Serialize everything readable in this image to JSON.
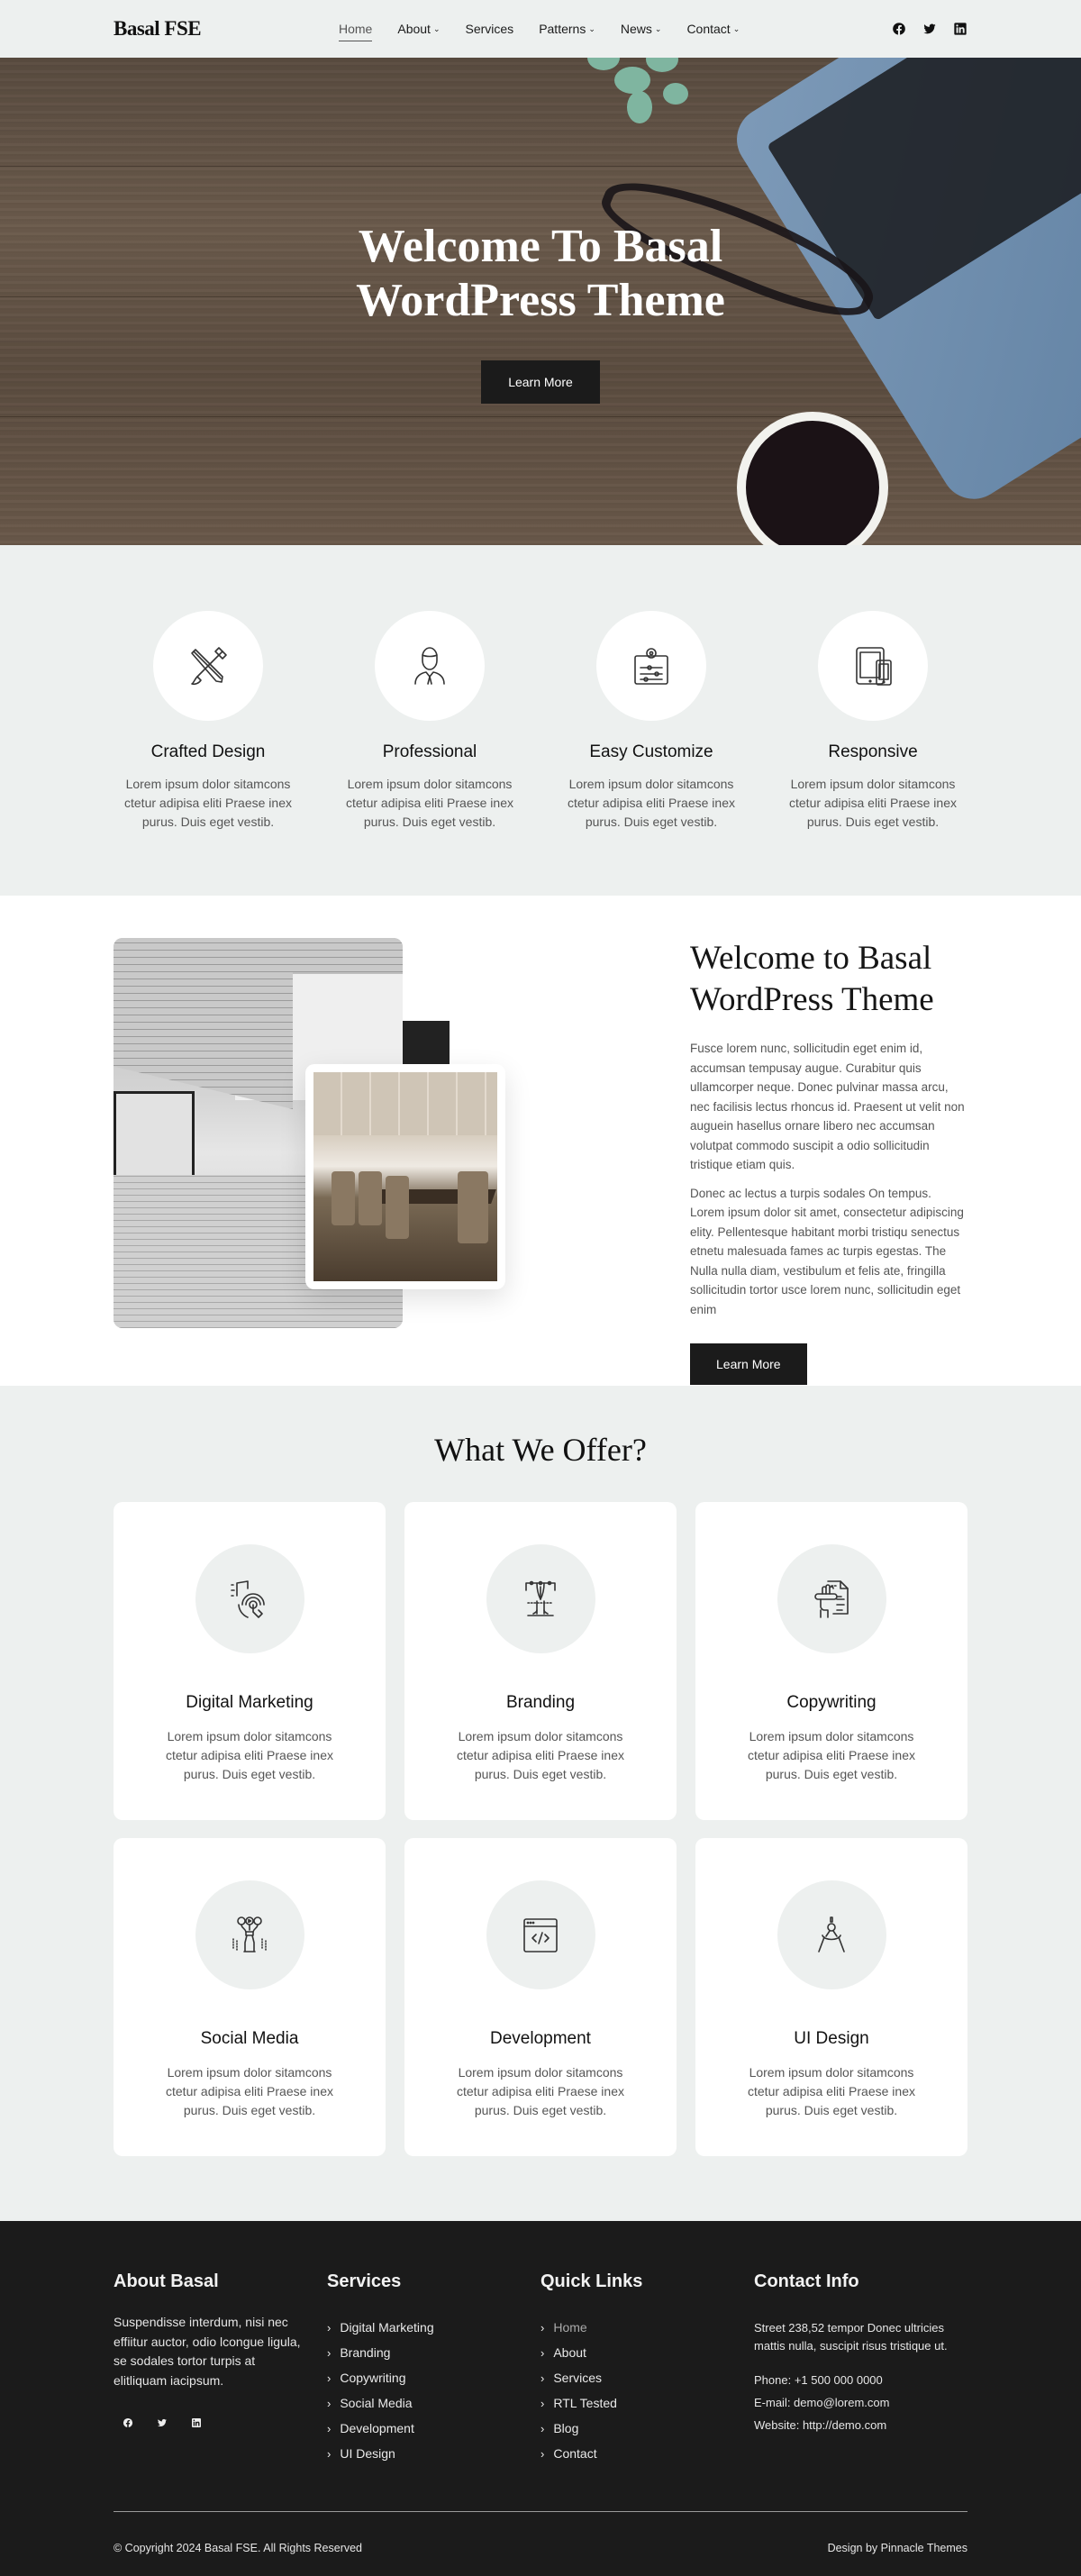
{
  "header": {
    "logo": "Basal FSE",
    "nav": [
      {
        "label": "Home",
        "active": true,
        "dropdown": false
      },
      {
        "label": "About",
        "dropdown": true
      },
      {
        "label": "Services",
        "dropdown": false
      },
      {
        "label": "Patterns",
        "dropdown": true
      },
      {
        "label": "News",
        "dropdown": true
      },
      {
        "label": "Contact",
        "dropdown": true
      }
    ],
    "social": [
      "facebook-icon",
      "twitter-icon",
      "linkedin-icon"
    ]
  },
  "hero": {
    "title_line1": "Welcome To Basal",
    "title_line2": "WordPress Theme",
    "button": "Learn More"
  },
  "features": [
    {
      "title": "Crafted Design",
      "desc": "Lorem ipsum dolor sitamcons ctetur adipisa eliti Praese inex purus. Duis eget vestib.",
      "icon": "pencil-brush-icon"
    },
    {
      "title": "Professional",
      "desc": "Lorem ipsum dolor sitamcons ctetur adipisa eliti Praese inex purus. Duis eget vestib.",
      "icon": "person-icon"
    },
    {
      "title": "Easy Customize",
      "desc": "Lorem ipsum dolor sitamcons ctetur adipisa eliti Praese inex purus. Duis eget vestib.",
      "icon": "settings-sliders-icon"
    },
    {
      "title": "Responsive",
      "desc": "Lorem ipsum dolor sitamcons ctetur adipisa eliti Praese inex purus. Duis eget vestib.",
      "icon": "devices-icon"
    }
  ],
  "welcome": {
    "title_line1": "Welcome to Basal",
    "title_line2": "WordPress Theme",
    "p1": "Fusce lorem nunc, sollicitudin eget enim id, accumsan tempusay augue. Curabitur quis ullamcorper neque. Donec pulvinar massa arcu, nec facilisis lectus rhoncus id. Praesent ut velit non auguein hasellus ornare libero nec accumsan volutpat commodo suscipit a odio sollicitudin tristique etiam quis.",
    "p2": "Donec ac lectus a turpis sodales On tempus. Lorem ipsum dolor sit amet, consectetur adipiscing elity. Pellentesque habitant morbi tristiqu senectus etnetu malesuada fames ac turpis egestas. The Nulla nulla diam, vestibulum et felis ate, fringilla sollicitudin tortor usce lorem nunc, sollicitudin eget enim",
    "button": "Learn More"
  },
  "offer": {
    "title": "What We Offer?",
    "cards": [
      {
        "title": "Digital Marketing",
        "desc": "Lorem ipsum dolor sitamcons ctetur adipisa eliti Praese inex purus. Duis eget vestib.",
        "icon": "touch-click-icon"
      },
      {
        "title": "Branding",
        "desc": "Lorem ipsum dolor sitamcons ctetur adipisa eliti Praese inex purus. Duis eget vestib.",
        "icon": "pen-tool-type-icon"
      },
      {
        "title": "Copywriting",
        "desc": "Lorem ipsum dolor sitamcons ctetur adipisa eliti Praese inex purus. Duis eget vestib.",
        "icon": "hand-writing-document-icon"
      },
      {
        "title": "Social Media",
        "desc": "Lorem ipsum dolor sitamcons ctetur adipisa eliti Praese inex purus. Duis eget vestib.",
        "icon": "social-strategy-icon"
      },
      {
        "title": "Development",
        "desc": "Lorem ipsum dolor sitamcons ctetur adipisa eliti Praese inex purus. Duis eget vestib.",
        "icon": "code-window-icon"
      },
      {
        "title": "UI Design",
        "desc": "Lorem ipsum dolor sitamcons ctetur adipisa eliti Praese inex purus. Duis eget vestib.",
        "icon": "compass-icon"
      }
    ]
  },
  "footer": {
    "about": {
      "title": "About Basal",
      "text": "Suspendisse interdum, nisi nec effiitur auctor, odio lcongue ligula, se sodales tortor turpis at elitliquam iacipsum."
    },
    "services": {
      "title": "Services",
      "items": [
        "Digital Marketing",
        "Branding",
        "Copywriting",
        "Social Media",
        "Development",
        "UI Design"
      ]
    },
    "quick_links": {
      "title": "Quick Links",
      "items": [
        "Home",
        "About",
        "Services",
        "RTL Tested",
        "Blog",
        "Contact"
      ]
    },
    "contact": {
      "title": "Contact Info",
      "address": "Street 238,52 tempor Donec ultricies mattis nulla, suscipit risus tristique ut.",
      "phone": "Phone: +1 500 000 0000",
      "email": "E-mail: demo@lorem.com",
      "website": "Website: http://demo.com"
    },
    "copyright": "© Copyright 2024 Basal FSE. All Rights Reserved",
    "credit": "Design by Pinnacle Themes"
  }
}
